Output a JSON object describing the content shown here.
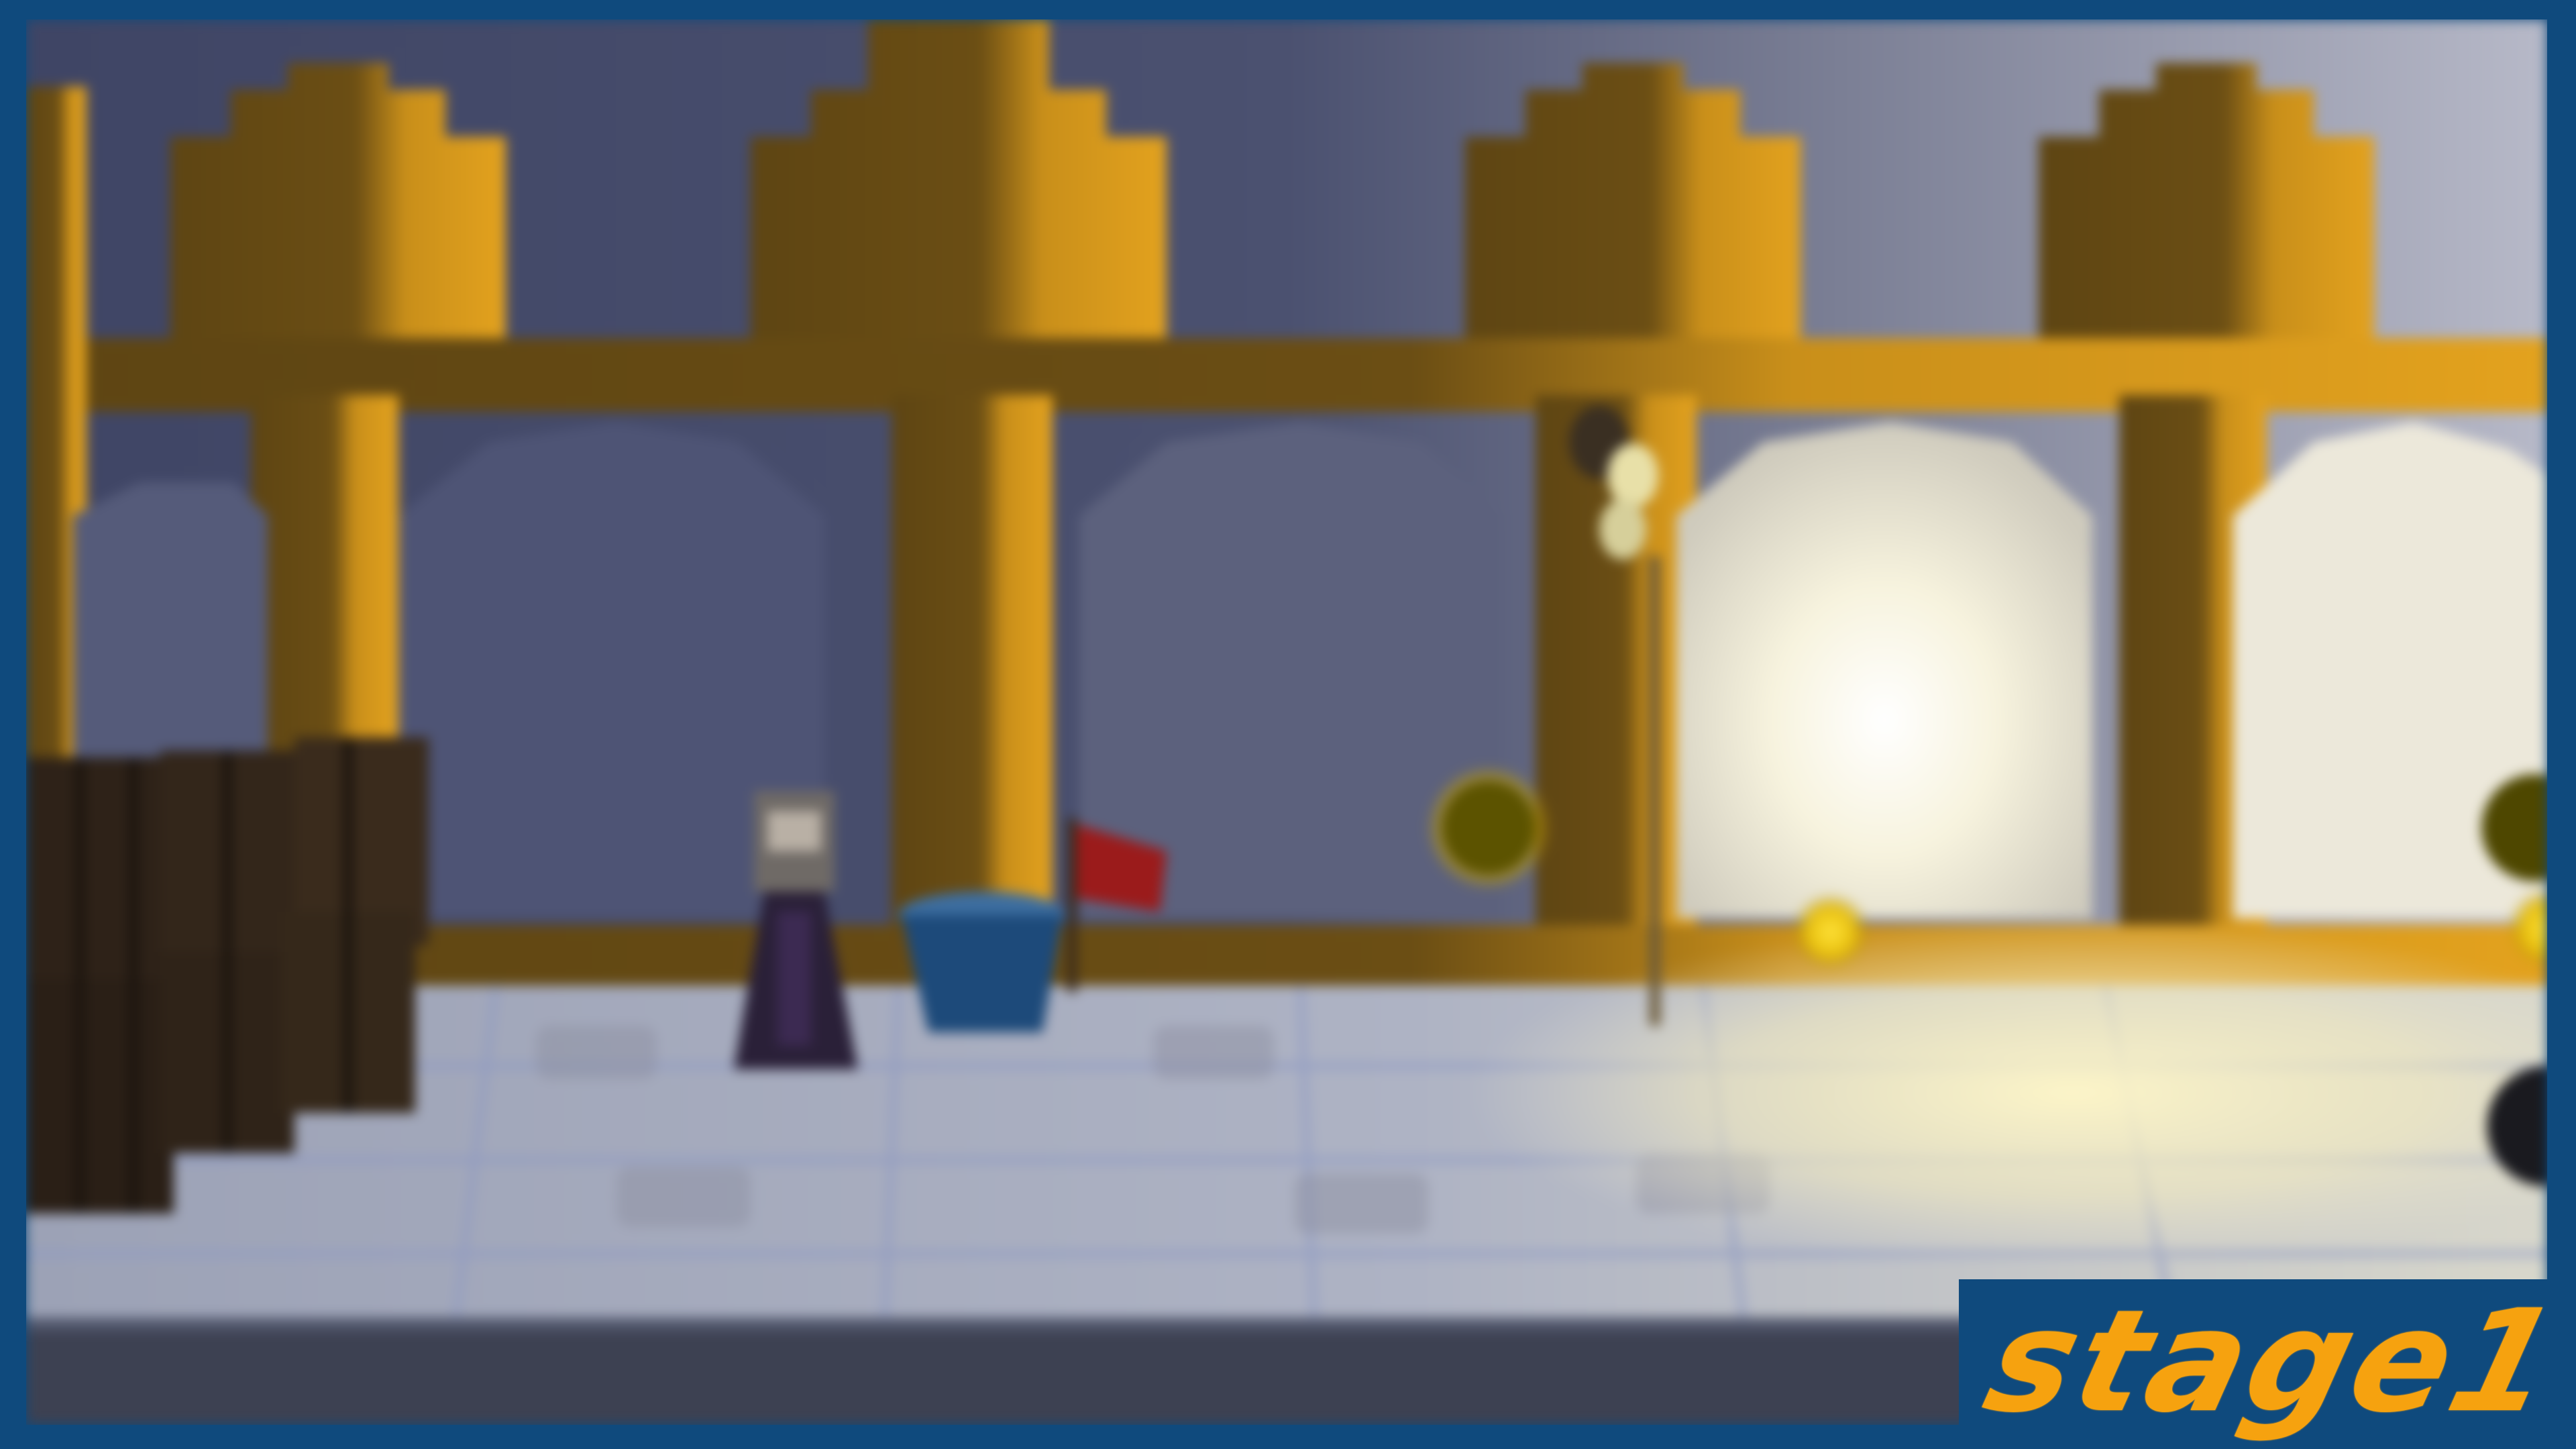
{
  "hud": {
    "stage_label": "stage1"
  },
  "colors": {
    "frame_blue": "#0f4a7d",
    "stage_text": "#f6a20f",
    "wall_wood": "#8a6418",
    "wall_plaster_dark": "#4f5576",
    "floor_tile": "#a7adbd",
    "light_glow": "#fff3b0"
  },
  "scene_objects": {
    "characters": [
      "player-character"
    ],
    "props": [
      "barrel-stack",
      "bucket",
      "red-flag",
      "wall-lamp",
      "glowing-orb",
      "floor-light-pool"
    ]
  }
}
